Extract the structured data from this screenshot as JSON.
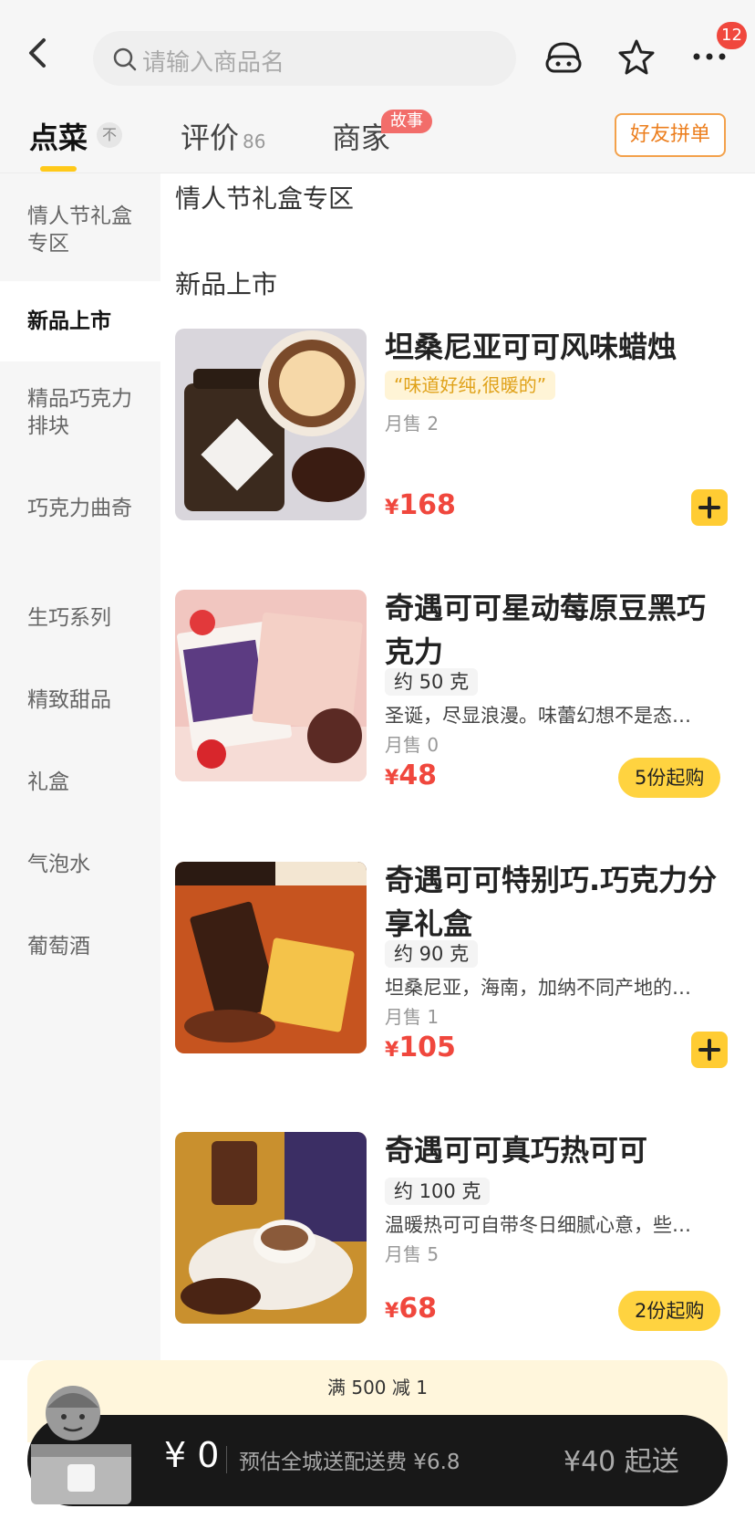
{
  "header": {
    "search_placeholder": "请输入商品名",
    "more_badge": "12",
    "icons": [
      "back-icon",
      "search-icon",
      "customer-service-icon",
      "star-icon",
      "more-icon"
    ]
  },
  "tabs": [
    {
      "label": "点菜",
      "active": true,
      "pin": "不"
    },
    {
      "label": "评价",
      "count": "86"
    },
    {
      "label": "商家",
      "badge": "故事"
    }
  ],
  "group_order_label": "好友拼单",
  "sidebar": {
    "items": [
      {
        "label": "情人节礼盒专区"
      },
      {
        "label": "新品上市",
        "active": true
      },
      {
        "label": "精品巧克力排块"
      },
      {
        "label": "巧克力曲奇"
      },
      {
        "label": "生巧系列"
      },
      {
        "label": "精致甜品"
      },
      {
        "label": "礼盒"
      },
      {
        "label": "气泡水"
      },
      {
        "label": "葡萄酒"
      }
    ]
  },
  "sections": {
    "first": "情人节礼盒专区",
    "second": "新品上市"
  },
  "products": [
    {
      "name": "坦桑尼亚可可风味蜡烛",
      "tagline": "“味道好纯,很暖的”",
      "sales": "月售 2",
      "price_symbol": "¥",
      "price": "168",
      "action": "add"
    },
    {
      "name": "奇遇可可星动莓原豆黑巧克力",
      "weight": "约 50 克",
      "desc": "圣诞，尽显浪漫。味蕾幻想不是态…",
      "sales": "月售 0",
      "price_symbol": "¥",
      "price": "48",
      "action": "5份起购"
    },
    {
      "name": "奇遇可可特别巧.巧克力分享礼盒",
      "weight": "约 90 克",
      "desc": "坦桑尼亚，海南，加纳不同产地的…",
      "sales": "月售 1",
      "price_symbol": "¥",
      "price": "105",
      "action": "add"
    },
    {
      "name": "奇遇可可真巧热可可",
      "weight": "约 100 克",
      "desc": "温暖热可可自带冬日细腻心意，些…",
      "sales": "月售 5",
      "price_symbol": "¥",
      "price": "68",
      "action": "2份起购"
    }
  ],
  "promo": "满 500 减 1",
  "cart": {
    "price": "¥ 0",
    "delivery": "预估全城送配送费 ¥6.8",
    "min_order": "¥40 起送"
  },
  "colors": {
    "accent": "#ffcc33",
    "price": "#f0473d",
    "badge": "#f0473d"
  }
}
